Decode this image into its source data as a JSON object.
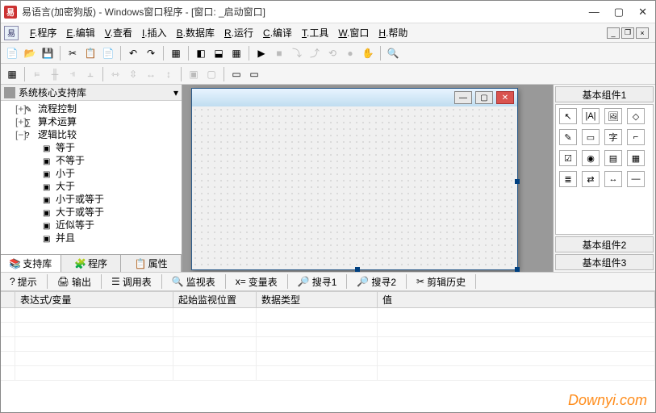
{
  "title": "易语言(加密狗版) - Windows窗口程序 - [窗口: _启动窗口]",
  "app_icon_text": "易",
  "menu": [
    "F.程序",
    "E.编辑",
    "V.查看",
    "I.插入",
    "B.数据库",
    "R.运行",
    "C.编译",
    "T.工具",
    "W.窗口",
    "H.帮助"
  ],
  "tree_root": "系统核心支持库",
  "tree": [
    {
      "level": 1,
      "exp": "+",
      "icon": "✎",
      "label": "流程控制"
    },
    {
      "level": 1,
      "exp": "+",
      "icon": "∑",
      "label": "算术运算"
    },
    {
      "level": 1,
      "exp": "−",
      "icon": "?",
      "label": "逻辑比较"
    },
    {
      "level": 2,
      "icon": "▣",
      "label": "等于"
    },
    {
      "level": 2,
      "icon": "▣",
      "label": "不等于"
    },
    {
      "level": 2,
      "icon": "▣",
      "label": "小于"
    },
    {
      "level": 2,
      "icon": "▣",
      "label": "大于"
    },
    {
      "level": 2,
      "icon": "▣",
      "label": "小于或等于"
    },
    {
      "level": 2,
      "icon": "▣",
      "label": "大于或等于"
    },
    {
      "level": 2,
      "icon": "▣",
      "label": "近似等于"
    },
    {
      "level": 2,
      "icon": "▣",
      "label": "并且"
    }
  ],
  "left_tabs": [
    {
      "icon": "📚",
      "label": "支持库",
      "active": true
    },
    {
      "icon": "🧩",
      "label": "程序",
      "active": false
    },
    {
      "icon": "📋",
      "label": "属性",
      "active": false
    }
  ],
  "right": {
    "group1": "基本组件1",
    "group2": "基本组件2",
    "group3": "基本组件3",
    "icons": [
      [
        "↖",
        "|A|",
        "🖼",
        "◇"
      ],
      [
        "✎",
        "▭",
        "字",
        "⌐"
      ],
      [
        "☑",
        "◉",
        "▤",
        "▦"
      ],
      [
        "≣",
        "⇄",
        "↔",
        "—"
      ]
    ]
  },
  "bottom_tabs": [
    {
      "icon": "?",
      "label": "提示"
    },
    {
      "icon": "🖨",
      "label": "输出"
    },
    {
      "icon": "☰",
      "label": "调用表"
    },
    {
      "icon": "🔍",
      "label": "监视表"
    },
    {
      "icon": "x=",
      "label": "变量表"
    },
    {
      "icon": "🔎",
      "label": "搜寻1"
    },
    {
      "icon": "🔎",
      "label": "搜寻2"
    },
    {
      "icon": "✂",
      "label": "剪辑历史"
    }
  ],
  "grid_headers": [
    "",
    "表达式/变量",
    "起始监视位置",
    "数据类型",
    "值"
  ],
  "watermark": "Downyi.com"
}
